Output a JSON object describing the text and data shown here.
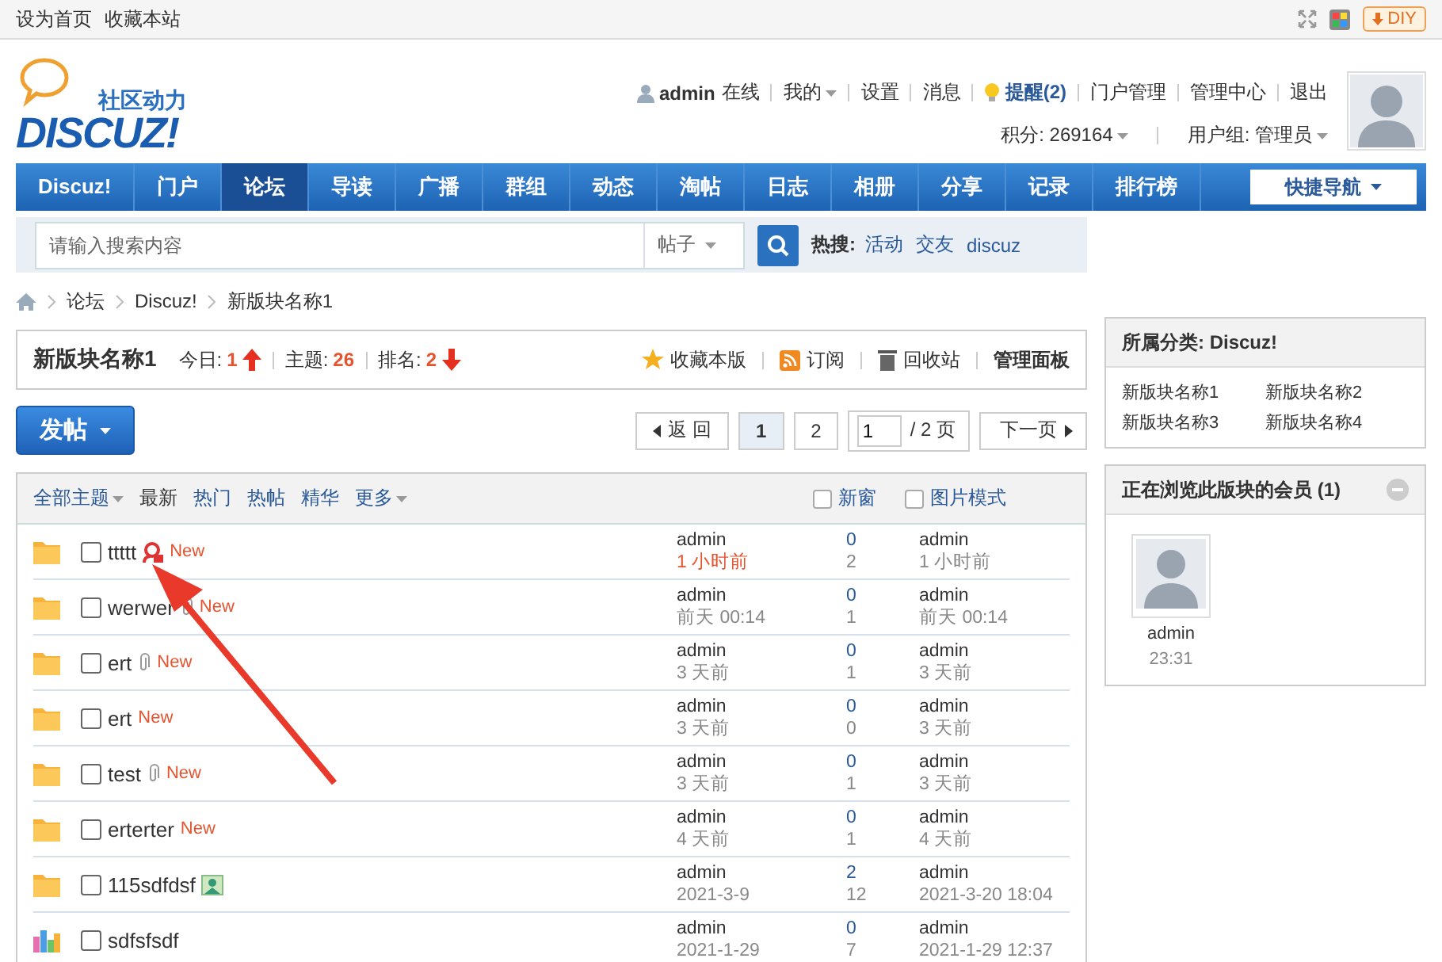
{
  "top_bar": {
    "links": [
      "设为首页",
      "收藏本站"
    ],
    "diy": "DIY"
  },
  "logo": {
    "tagline": "社区动力",
    "name": "DISCUZ!"
  },
  "user": {
    "name": "admin",
    "status": "在线",
    "links": [
      {
        "label": "我的",
        "dropdown": true,
        "bold": false
      },
      {
        "label": "设置",
        "dropdown": false,
        "bold": false
      },
      {
        "label": "消息",
        "dropdown": false,
        "bold": false
      },
      {
        "label": "提醒(2)",
        "dropdown": false,
        "bold": true
      },
      {
        "label": "门户管理",
        "dropdown": false,
        "bold": false
      },
      {
        "label": "管理中心",
        "dropdown": false,
        "bold": false
      },
      {
        "label": "退出",
        "dropdown": false,
        "bold": false
      }
    ],
    "credits": "积分: 269164",
    "group": "用户组: 管理员"
  },
  "nav": {
    "items": [
      {
        "label": "Discuz!",
        "selected": false
      },
      {
        "label": "门户",
        "selected": false
      },
      {
        "label": "论坛",
        "selected": true
      },
      {
        "label": "导读",
        "selected": false
      },
      {
        "label": "广播",
        "selected": false
      },
      {
        "label": "群组",
        "selected": false
      },
      {
        "label": "动态",
        "selected": false
      },
      {
        "label": "淘帖",
        "selected": false
      },
      {
        "label": "日志",
        "selected": false
      },
      {
        "label": "相册",
        "selected": false
      },
      {
        "label": "分享",
        "selected": false
      },
      {
        "label": "记录",
        "selected": false
      },
      {
        "label": "排行榜",
        "selected": false
      }
    ],
    "quick_nav": "快捷导航"
  },
  "search": {
    "placeholder": "请输入搜索内容",
    "type": "帖子",
    "hot_label": "热搜:",
    "hot": [
      "活动",
      "交友",
      "discuz"
    ]
  },
  "breadcrumb": [
    "论坛",
    "Discuz!",
    "新版块名称1"
  ],
  "forum": {
    "name": "新版块名称1",
    "stats": [
      {
        "label": "今日:",
        "value": "1",
        "kind": "rising"
      },
      {
        "label": "主题:",
        "value": "26",
        "kind": "steady"
      },
      {
        "label": "排名:",
        "value": "2",
        "kind": "falling"
      }
    ],
    "actions": [
      {
        "label": "收藏本版",
        "kind": "favorite"
      },
      {
        "label": "订阅",
        "kind": "subscribe"
      },
      {
        "label": "回收站",
        "kind": "recycle"
      },
      {
        "label": "管理面板",
        "kind": "manage"
      }
    ]
  },
  "post_button": "发帖",
  "pagination": {
    "back": "返 回",
    "pages": [
      {
        "label": "1",
        "selected": true
      },
      {
        "label": "2",
        "selected": false
      }
    ],
    "page_input": "1",
    "total": "/ 2 页",
    "next": "下一页"
  },
  "filters": [
    {
      "label": "全部主题",
      "dropdown": true
    },
    {
      "label": "最新",
      "dropdown": false
    },
    {
      "label": "热门",
      "dropdown": false
    },
    {
      "label": "热帖",
      "dropdown": false
    },
    {
      "label": "精华",
      "dropdown": false
    },
    {
      "label": "更多",
      "dropdown": true
    }
  ],
  "options": [
    {
      "label": "新窗",
      "checked": false
    },
    {
      "label": "图片模式",
      "checked": false
    }
  ],
  "threads": [
    {
      "kind": "folder",
      "title": "ttttt",
      "checked": false,
      "badge": {
        "kind": "lock"
      },
      "new": "New",
      "author": "admin",
      "date": "1 小时前",
      "recent": true,
      "replies": "0",
      "views": "2",
      "last_poster": "admin",
      "last_time": "1 小时前"
    },
    {
      "kind": "folder",
      "title": "werwer",
      "checked": false,
      "badge": {
        "kind": "attachment"
      },
      "new": "New",
      "author": "admin",
      "date": "前天 00:14",
      "recent": false,
      "replies": "0",
      "views": "1",
      "last_poster": "admin",
      "last_time": "前天 00:14"
    },
    {
      "kind": "folder",
      "title": "ert",
      "checked": false,
      "badge": {
        "kind": "attachment"
      },
      "new": "New",
      "author": "admin",
      "date": "3 天前",
      "recent": false,
      "replies": "0",
      "views": "1",
      "last_poster": "admin",
      "last_time": "3 天前"
    },
    {
      "kind": "folder",
      "title": "ert",
      "checked": false,
      "new": "New",
      "author": "admin",
      "date": "3 天前",
      "recent": false,
      "replies": "0",
      "views": "0",
      "last_poster": "admin",
      "last_time": "3 天前"
    },
    {
      "kind": "folder",
      "title": "test",
      "checked": false,
      "badge": {
        "kind": "attachment"
      },
      "new": "New",
      "author": "admin",
      "date": "3 天前",
      "recent": false,
      "replies": "0",
      "views": "1",
      "last_poster": "admin",
      "last_time": "3 天前"
    },
    {
      "kind": "folder",
      "title": "erterter",
      "checked": false,
      "new": "New",
      "author": "admin",
      "date": "4 天前",
      "recent": false,
      "replies": "0",
      "views": "1",
      "last_poster": "admin",
      "last_time": "4 天前"
    },
    {
      "kind": "folder",
      "title": "115sdfdsf",
      "checked": false,
      "badge": {
        "kind": "image"
      },
      "author": "admin",
      "date": "2021-3-9",
      "recent": false,
      "replies": "2",
      "views": "12",
      "last_poster": "admin",
      "last_time": "2021-3-20 18:04"
    },
    {
      "kind": "poll",
      "title": "sdfsfsdf",
      "checked": false,
      "author": "admin",
      "date": "2021-1-29",
      "recent": false,
      "replies": "0",
      "views": "7",
      "last_poster": "admin",
      "last_time": "2021-1-29 12:37"
    }
  ],
  "sidebar": {
    "category": {
      "title": "所属分类: Discuz!",
      "forums": [
        "新版块名称1",
        "新版块名称2",
        "新版块名称3",
        "新版块名称4"
      ]
    },
    "viewers": {
      "title": "正在浏览此版块的会员 (1)",
      "members": [
        {
          "name": "admin",
          "time": "23:31"
        }
      ]
    }
  }
}
